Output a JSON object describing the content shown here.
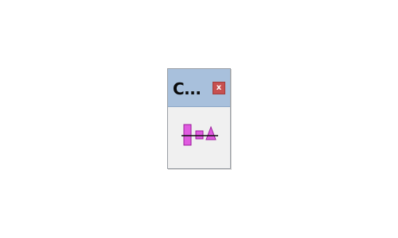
{
  "window": {
    "title": "C...",
    "close_label": "x",
    "titlebar_color": "#a8c0dc",
    "close_color": "#c75050"
  },
  "toolbar": {
    "items": [
      {
        "icon": "align-distribute-centers-icon",
        "accent": "#e05be0"
      }
    ]
  }
}
